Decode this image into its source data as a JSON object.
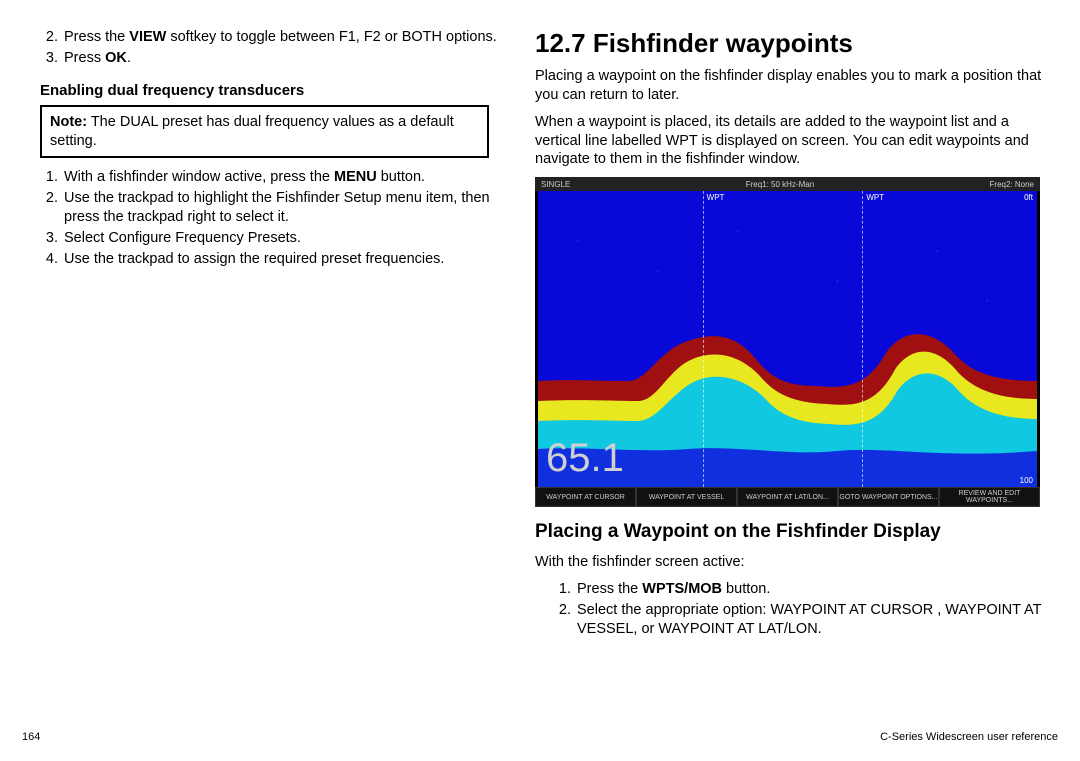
{
  "left": {
    "steps_top": [
      {
        "pre": "Press the ",
        "bold": "VIEW",
        "post": " softkey to toggle between F1, F2 or BOTH options."
      },
      {
        "pre": "Press ",
        "bold": "OK",
        "post": "."
      }
    ],
    "steps_top_start": 2,
    "subhead": "Enabling dual frequency transducers",
    "note_label": "Note:",
    "note_text": " The DUAL preset has dual frequency values as a default setting.",
    "steps_bottom": [
      {
        "pre": "With a fishfinder window active, press the ",
        "bold": "MENU",
        "post": " button."
      },
      {
        "pre": "Use the trackpad to highlight the Fishfinder Setup menu item, then press the trackpad right to select it.",
        "bold": "",
        "post": ""
      },
      {
        "pre": "Select Configure Frequency Presets.",
        "bold": "",
        "post": ""
      },
      {
        "pre": "Use the trackpad to assign the required preset frequencies.",
        "bold": "",
        "post": ""
      }
    ]
  },
  "right": {
    "title": "12.7 Fishfinder waypoints",
    "p1": "Placing a waypoint on the fishfinder display enables you to mark a position that you can return to later.",
    "p2": "When a waypoint is placed, its details are added to the waypoint list and a vertical line labelled WPT is displayed on screen. You can edit waypoints and navigate to them in the fishfinder window.",
    "image": {
      "top_left": "SINGLE",
      "top_mid": "Freq1: 50 kHz-Man",
      "top_right": "Freq2: None",
      "depth": "65.1",
      "scale_top": "0ft",
      "scale_bot": "100",
      "wpt_label": "WPT",
      "softkeys": [
        "WAYPOINT AT CURSOR",
        "WAYPOINT AT VESSEL",
        "WAYPOINT AT LAT/LON...",
        "GOTO WAYPOINT OPTIONS...",
        "REVIEW AND EDIT WAYPOINTS..."
      ]
    },
    "subhead2": "Placing a Waypoint on the Fishfinder Display",
    "intro": "With the fishfinder screen active:",
    "steps": [
      {
        "pre": "Press the ",
        "bold": "WPTS/MOB",
        "post": " button."
      },
      {
        "pre": "Select the appropriate option: WAYPOINT AT CURSOR , WAYPOINT AT VESSEL, or WAYPOINT AT LAT/LON.",
        "bold": "",
        "post": ""
      }
    ]
  },
  "footer": {
    "left": "164",
    "right": "C-Series Widescreen user reference"
  }
}
